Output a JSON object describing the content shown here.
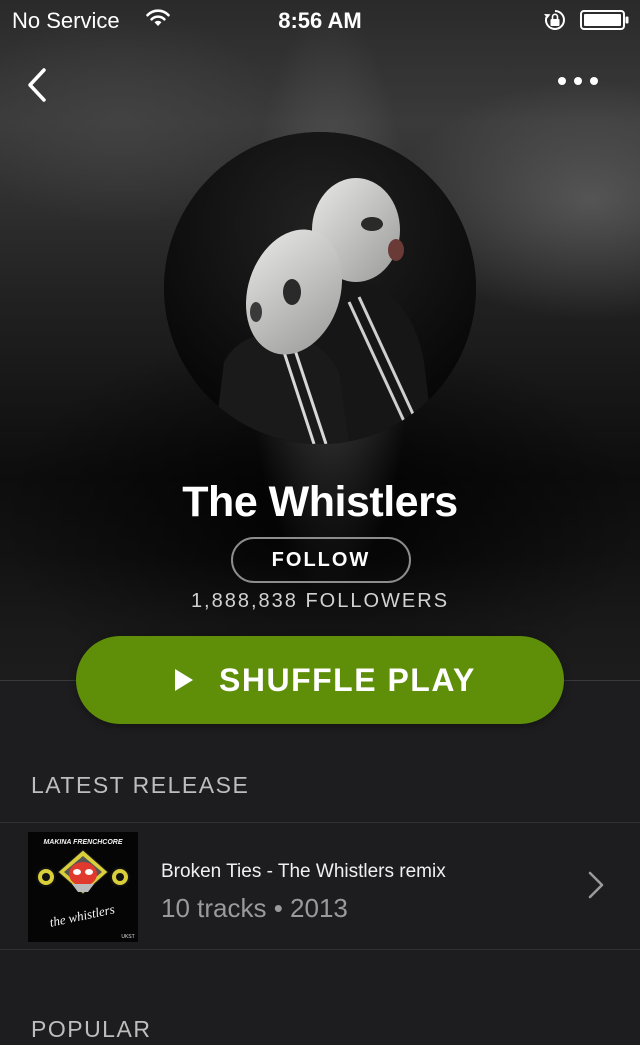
{
  "status_bar": {
    "carrier": "No Service",
    "time": "8:56 AM"
  },
  "icons": {
    "back": "chevron-left-icon",
    "more": "more-dots-icon",
    "wifi": "wifi-icon",
    "orientation_lock": "orientation-lock-icon",
    "battery": "battery-icon",
    "play": "play-icon",
    "chevron": "chevron-right-icon"
  },
  "artist": {
    "name": "The Whistlers",
    "follow_label": "FOLLOW",
    "followers": "1,888,838 FOLLOWERS"
  },
  "actions": {
    "shuffle_label": "SHUFFLE PLAY"
  },
  "colors": {
    "accent": "#5f8f08",
    "background": "#1d1d1f"
  },
  "sections": {
    "latest_release": {
      "title": "LATEST RELEASE",
      "release": {
        "title": "Broken Ties - The Whistlers remix",
        "meta": "10 tracks • 2013",
        "cover_top_text": "MAKINA FRENCHCORE",
        "cover_logo_text": "the whistlers",
        "cover_badge_text": "UKST"
      }
    },
    "popular": {
      "title": "POPULAR"
    }
  }
}
